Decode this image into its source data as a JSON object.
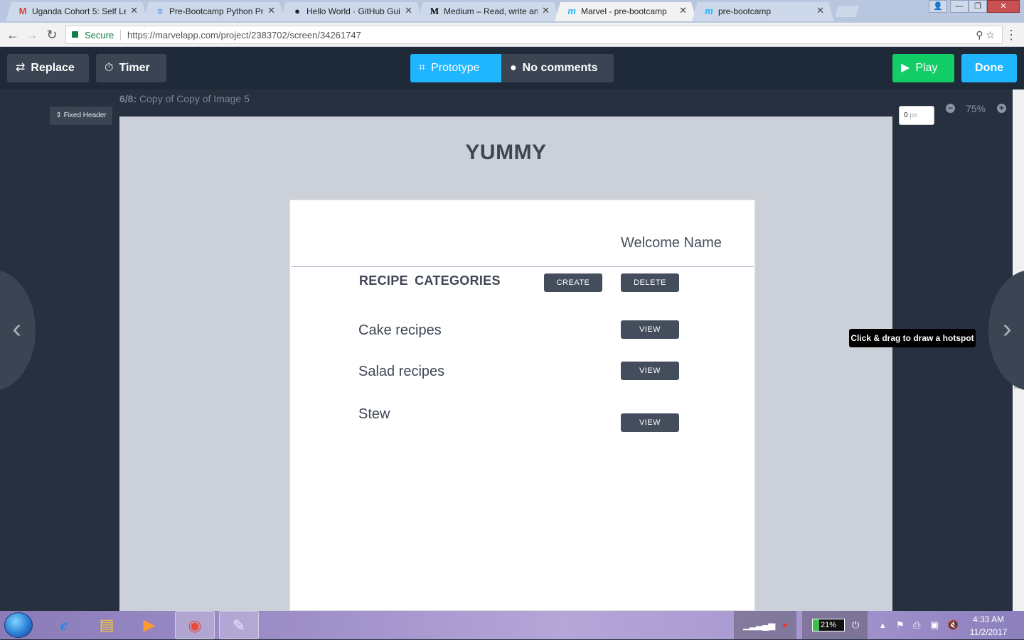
{
  "browser": {
    "tabs": [
      {
        "title": "Uganda Cohort 5: Self Le",
        "icon": "gmail-icon",
        "glyph": "M",
        "color": "#d44638",
        "active": false
      },
      {
        "title": "Pre-Bootcamp Python Pr",
        "icon": "google-docs-icon",
        "glyph": "≡",
        "color": "#4285f4",
        "active": false
      },
      {
        "title": "Hello World · GitHub Gui",
        "icon": "github-icon",
        "glyph": "●",
        "color": "#222222",
        "active": false
      },
      {
        "title": "Medium – Read, write an",
        "icon": "medium-icon",
        "glyph": "M",
        "color": "#000000",
        "active": false
      },
      {
        "title": "Marvel - pre-bootcamp",
        "icon": "marvel-icon",
        "glyph": "m",
        "color": "#1fb6ff",
        "active": true
      },
      {
        "title": "pre-bootcamp",
        "icon": "marvel-icon",
        "glyph": "m",
        "color": "#1fb6ff",
        "active": false
      }
    ],
    "close_glyph": "✕",
    "window_controls": {
      "user": "👤",
      "minimize": "—",
      "maximize": "❐",
      "close": "✕"
    },
    "secure_label": "Secure",
    "url": "https://marvelapp.com/project/2383702/screen/34261747",
    "nav": {
      "back": "←",
      "forward": "→",
      "reload": "↻",
      "menu": "⋮"
    },
    "omnibox_icons": "⚲  ☆"
  },
  "marvel": {
    "header": {
      "replace_label": "Replace",
      "replace_icon": "⇄",
      "timer_label": "Timer",
      "timer_icon": "⏱",
      "prototype_label": "Prototype",
      "prototype_icon": "⌗",
      "comments_label": "No comments",
      "comments_icon": "●",
      "play_label": "Play",
      "play_icon": "▶",
      "done_label": "Done",
      "colors": {
        "prototype": "#1fb6ff",
        "play": "#13ce66",
        "done": "#1fb6ff",
        "dark_button": "#3a4453",
        "comments": "#3a4453"
      }
    },
    "screen_counter": "6/8:",
    "screen_name": "Copy of Copy of Image 5",
    "fixed_header_label": "⇕ Fixed Header",
    "zoom": {
      "input_value": "0",
      "input_unit": "px",
      "minus": "−",
      "plus": "+",
      "level": "75%"
    },
    "nav_prev": "‹",
    "nav_next": "›",
    "tooltip": "Click & drag to draw a hotspot"
  },
  "mockup": {
    "title": "YUMMY",
    "welcome": "Welcome Name",
    "heading": "RECIPE CATEGORIES",
    "create_label": "CREATE",
    "delete_label": "DELETE",
    "recipes": [
      {
        "name": "Cake recipes",
        "action": "VIEW"
      },
      {
        "name": "Salad recipes",
        "action": "VIEW"
      },
      {
        "name": "Stew",
        "action": "VIEW"
      }
    ]
  },
  "taskbar": {
    "apps": [
      {
        "name": "internet-explorer-icon",
        "glyph": "e"
      },
      {
        "name": "file-explorer-icon",
        "glyph": "▤"
      },
      {
        "name": "media-player-icon",
        "glyph": "▶"
      },
      {
        "name": "chrome-icon",
        "glyph": "◉"
      },
      {
        "name": "paint-icon",
        "glyph": "✎"
      }
    ],
    "battery": "21%",
    "time": "4:33 AM",
    "date": "11/2/2017"
  }
}
